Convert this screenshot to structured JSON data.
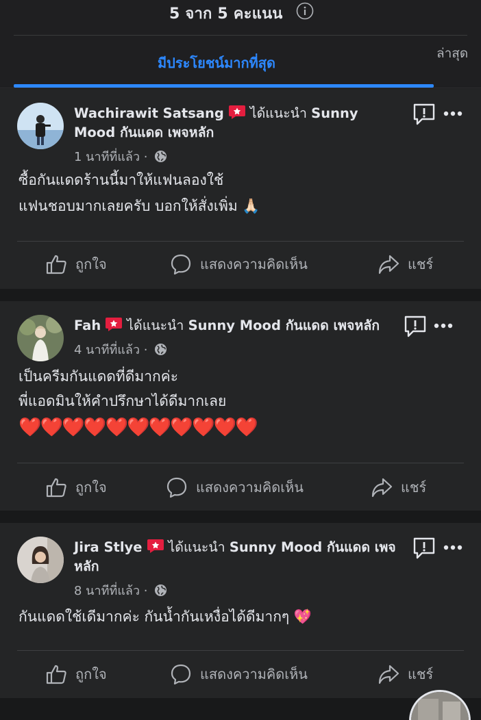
{
  "header": {
    "rating_text": "5 จาก 5 คะแนน"
  },
  "tabs": {
    "most_relevant": "มีประโยชน์มากที่สุด",
    "latest": "ล่าสุด"
  },
  "reviews": [
    {
      "username": "Wachirawit Satsang",
      "recommend_text": "ได้แนะนำ",
      "page_name": "Sunny Mood กันแดด เพจหลัก",
      "time": "1 นาทีที่แล้ว · ",
      "text": "ซื้อกันแดดร้านนี้มาให้แฟนลองใช้\nแฟนชอบมากเลยครับ บอกให้สั่งเพิ่ม 🙏🏻"
    },
    {
      "username": "Fah",
      "recommend_text": "ได้แนะนำ",
      "page_name": "Sunny Mood กันแดด เพจหลัก",
      "time": "4 นาทีที่แล้ว · ",
      "text": "เป็นครีมกันแดดที่ดีมากค่ะ\nพี่แอดมินให้คำปรึกษาได้ดีมากเลย",
      "hearts": "❤️❤️❤️❤️❤️❤️❤️❤️❤️❤️❤️"
    },
    {
      "username": "Jira Stlye",
      "recommend_text": "ได้แนะนำ",
      "page_name": "Sunny Mood กันแดด เพจหลัก",
      "time": "8 นาทีที่แล้ว · ",
      "text": "กันแดดใช้เดีมากค่ะ กันน้ำกันเหงื่อได้ดีมากๆ 💖"
    }
  ],
  "actions": {
    "like": "ถูกใจ",
    "comment": "แสดงความคิดเห็น",
    "share": "แชร์"
  },
  "colors": {
    "background": "#18191a",
    "card": "#242526",
    "accent": "#2d88ff",
    "badge": "#e41e3f",
    "text_primary": "#e4e6eb",
    "text_secondary": "#b0b3b8"
  }
}
